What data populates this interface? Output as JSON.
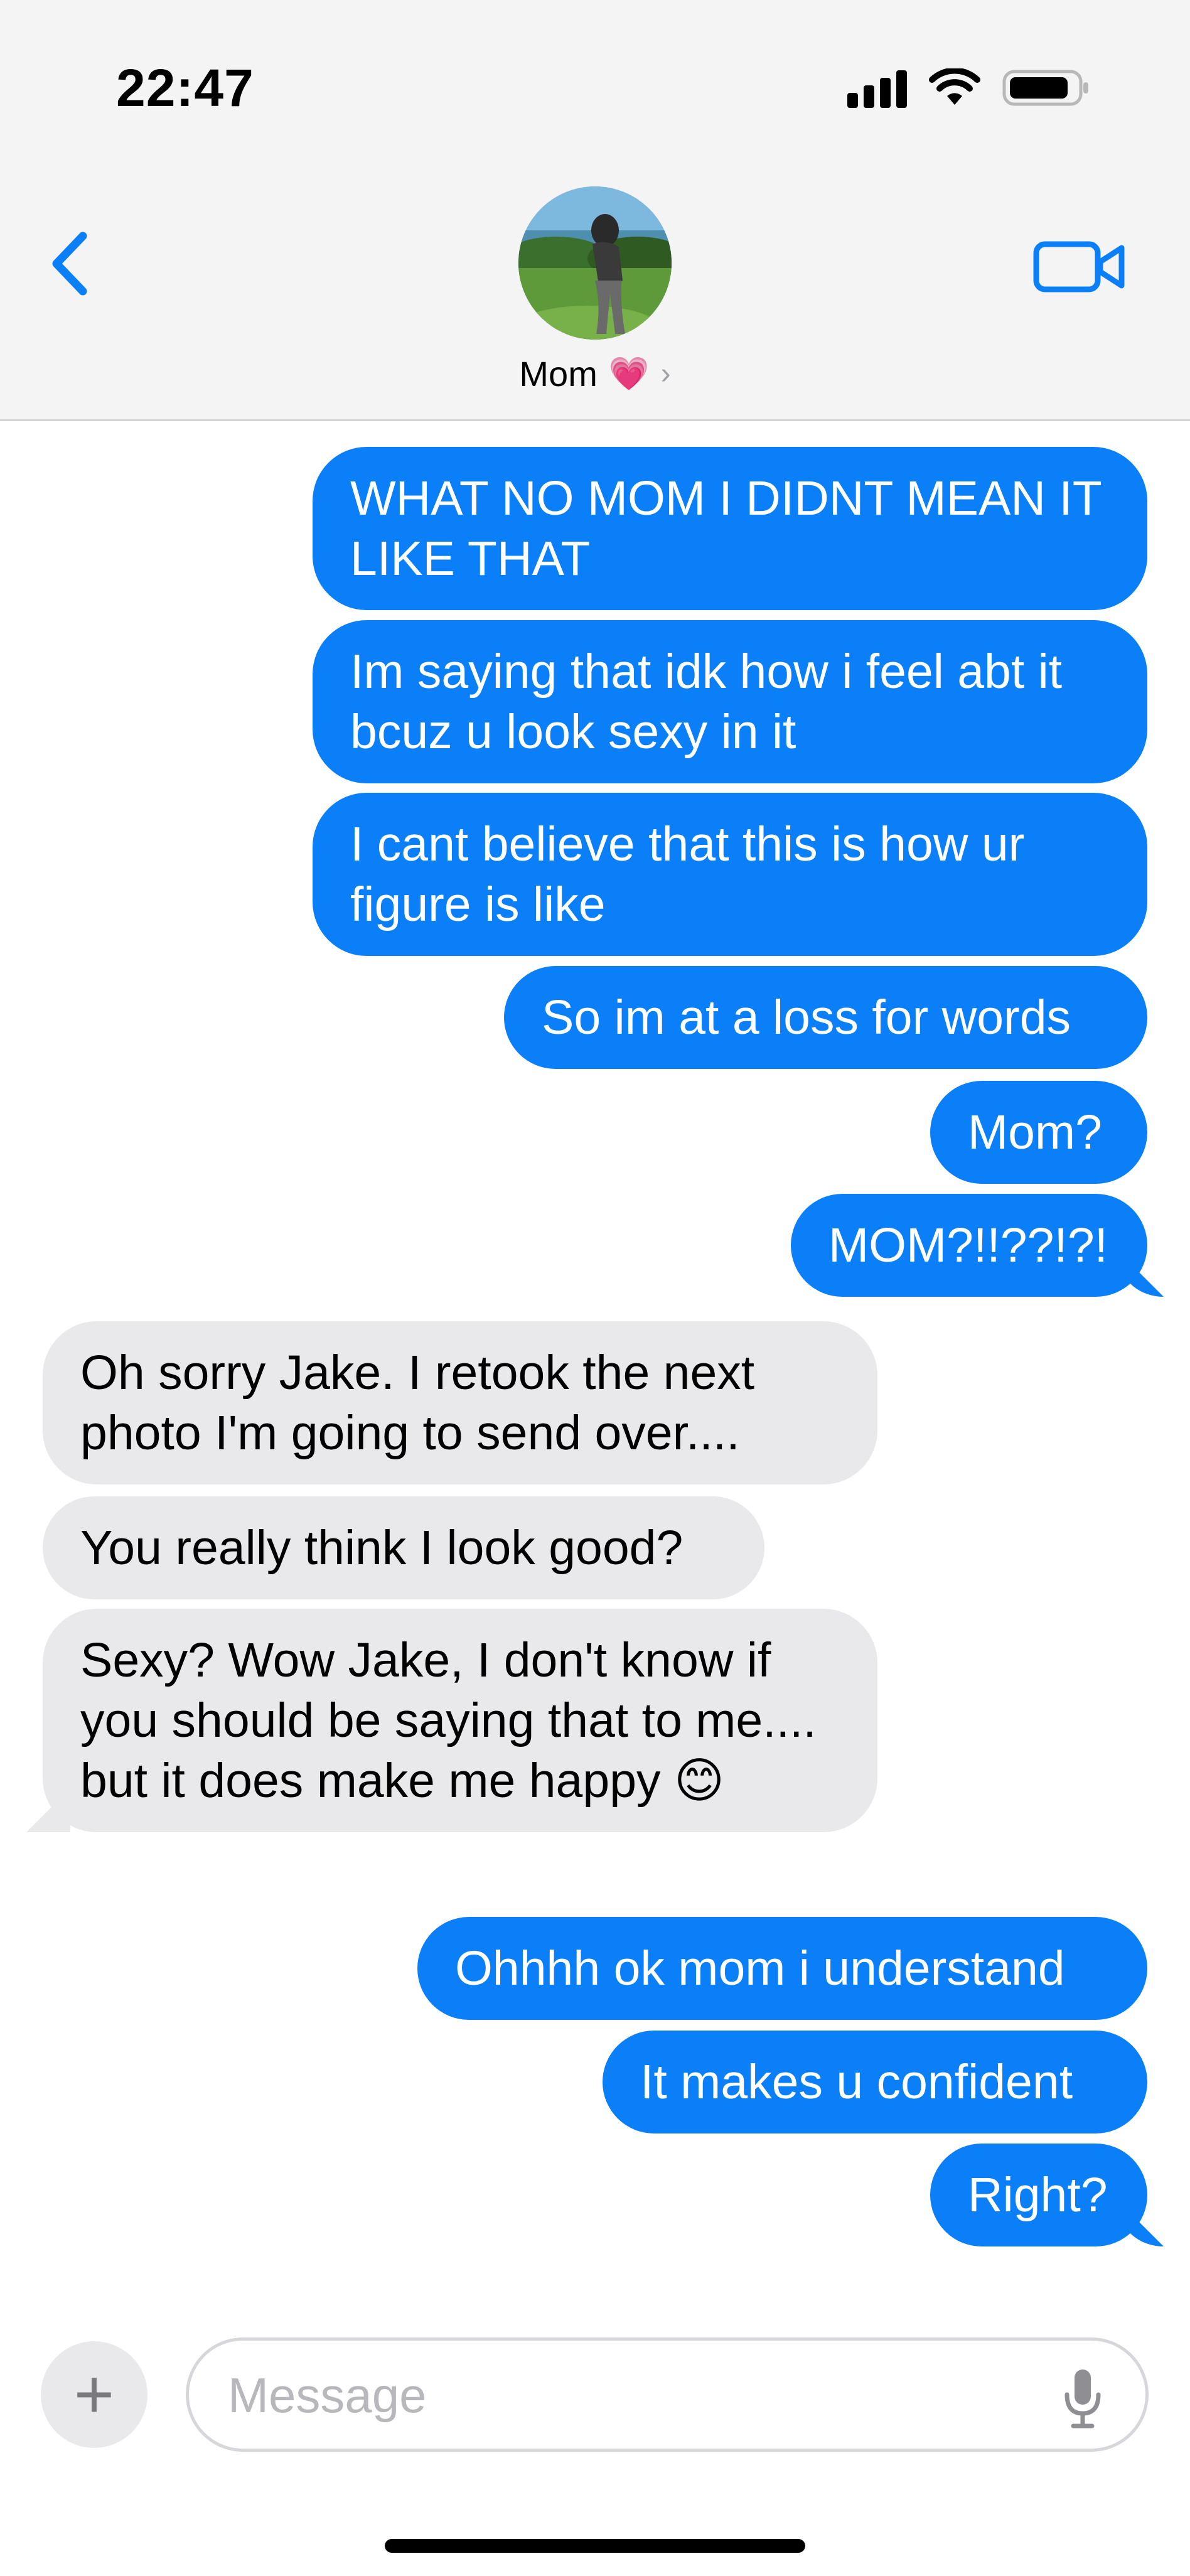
{
  "status_bar": {
    "time": "22:47",
    "icons": [
      "signal-icon",
      "wifi-icon",
      "battery-icon"
    ]
  },
  "header": {
    "contact_name": "Mom",
    "contact_emoji": "💗",
    "chevron": "›",
    "back_icon": "chevron-left-icon",
    "video_icon": "video-camera-icon"
  },
  "messages": [
    {
      "side": "sent",
      "text": "WHAT NO MOM I DIDNT MEAN IT LIKE THAT"
    },
    {
      "side": "sent",
      "text": "Im saying that idk how i feel abt it bcuz u look sexy in it"
    },
    {
      "side": "sent",
      "text": "I cant believe that this is how ur figure is like"
    },
    {
      "side": "sent",
      "text": "So im at a loss for words"
    },
    {
      "side": "sent",
      "text": "Mom?"
    },
    {
      "side": "sent",
      "text": "MOM?!!??!?!"
    },
    {
      "side": "received",
      "text": "Oh sorry Jake. I retook the next photo I'm going to send over...."
    },
    {
      "side": "received",
      "text": "You really think I look good?"
    },
    {
      "side": "received",
      "text": "Sexy? Wow Jake, I don't know if you should be saying that to me.... but it does make me happy 😊"
    },
    {
      "side": "sent",
      "text": "Ohhhh ok mom i understand"
    },
    {
      "side": "sent",
      "text": "It makes u confident"
    },
    {
      "side": "sent",
      "text": "Right?"
    }
  ],
  "input_bar": {
    "plus_label": "+",
    "placeholder": "Message"
  },
  "colors": {
    "sent_bubble": "#0a7ff7",
    "received_bubble": "#e9e9eb",
    "header_bg": "#f4f4f4",
    "accent": "#0a7ff7"
  }
}
